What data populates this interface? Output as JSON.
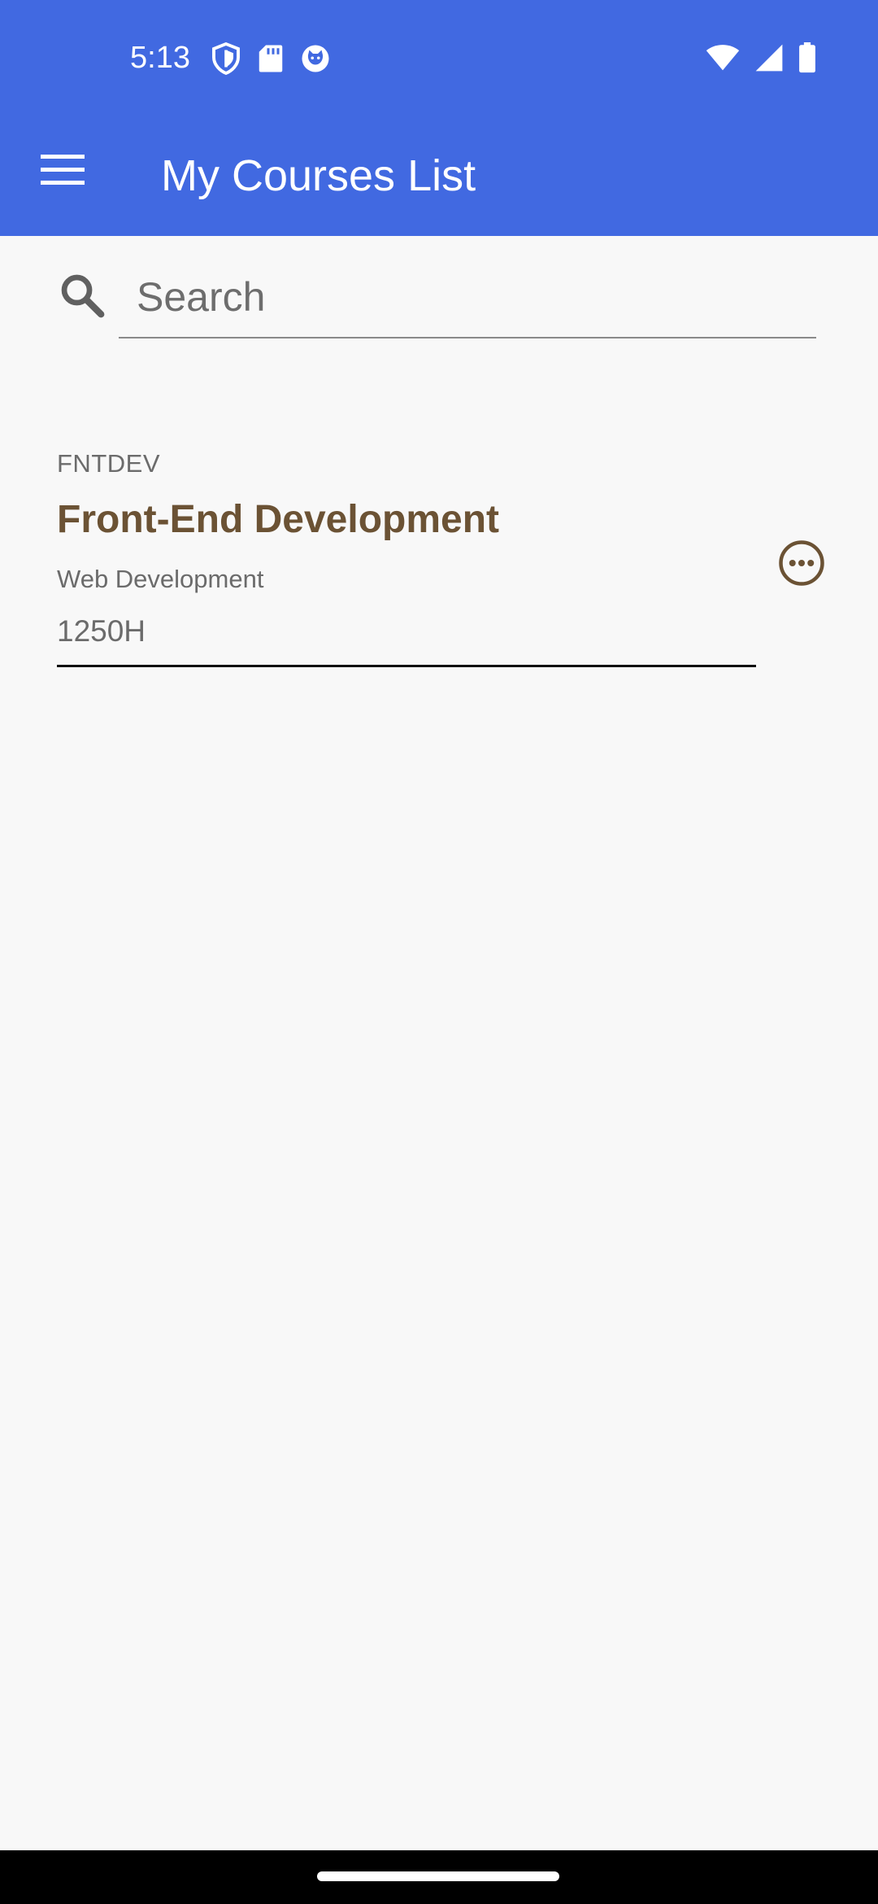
{
  "status_bar": {
    "time": "5:13",
    "left_icons": [
      "shield-icon",
      "sd-card-icon",
      "cat-face-icon"
    ],
    "right_icons": [
      "wifi-icon",
      "signal-icon",
      "battery-icon"
    ]
  },
  "app_bar": {
    "title": "My Courses List",
    "menu_icon": "hamburger-menu-icon",
    "color": "#4169e1"
  },
  "search": {
    "placeholder": "Search",
    "value": ""
  },
  "courses": [
    {
      "code": "FNTDEV",
      "title": "Front-End Development",
      "category": "Web Development",
      "hours": "1250H",
      "title_color": "#6b5234"
    }
  ]
}
